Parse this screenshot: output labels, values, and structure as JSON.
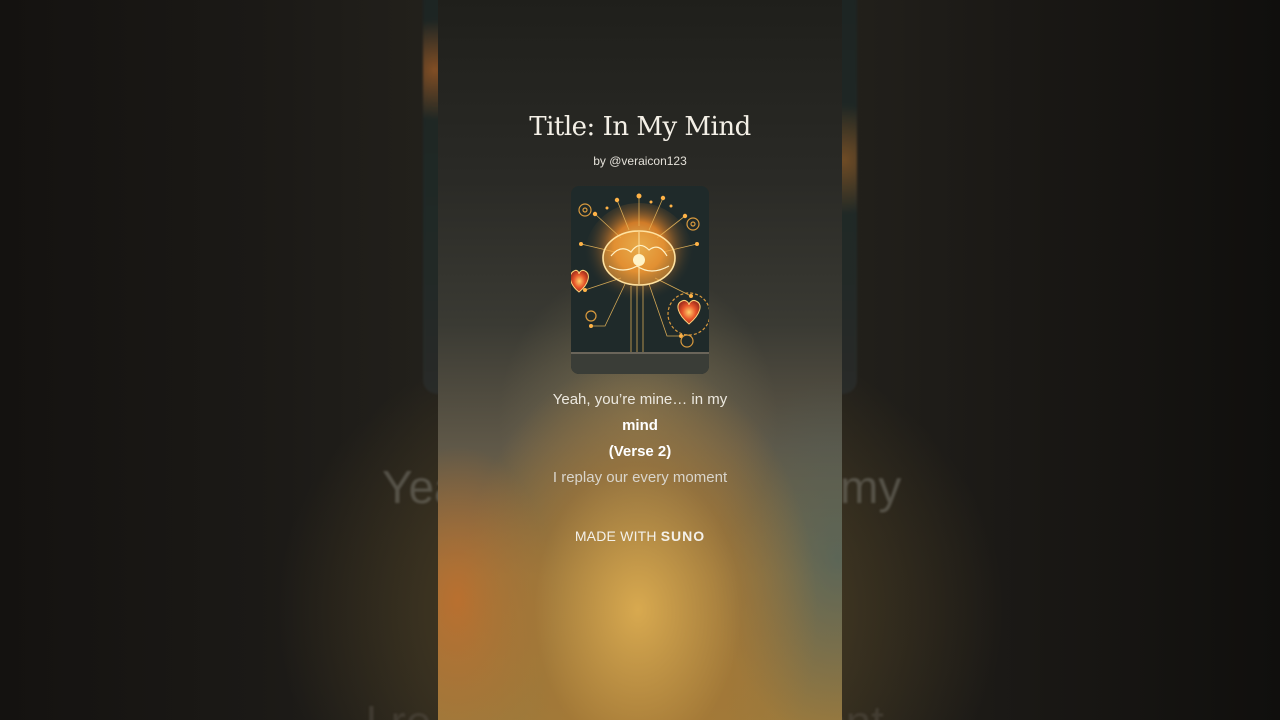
{
  "song": {
    "title": "Title: In My Mind",
    "byline": "by @veraicon123"
  },
  "artwork": {
    "icon": "brain-circuit-heart-artwork"
  },
  "lyrics": {
    "line1": "Yeah, you’re mine… in my",
    "line2": "mind",
    "line3": "(Verse 2)",
    "line4": "I replay our every moment"
  },
  "background": {
    "lyric_left": "Yea",
    "lyric_right": "my",
    "lyric_bottom_left": "I re",
    "lyric_bottom_right": "ent"
  },
  "footer": {
    "made_with": "MADE WITH",
    "brand": "SUNO"
  },
  "colors": {
    "accent": "#d8a850",
    "panel_dark": "#22201b"
  }
}
